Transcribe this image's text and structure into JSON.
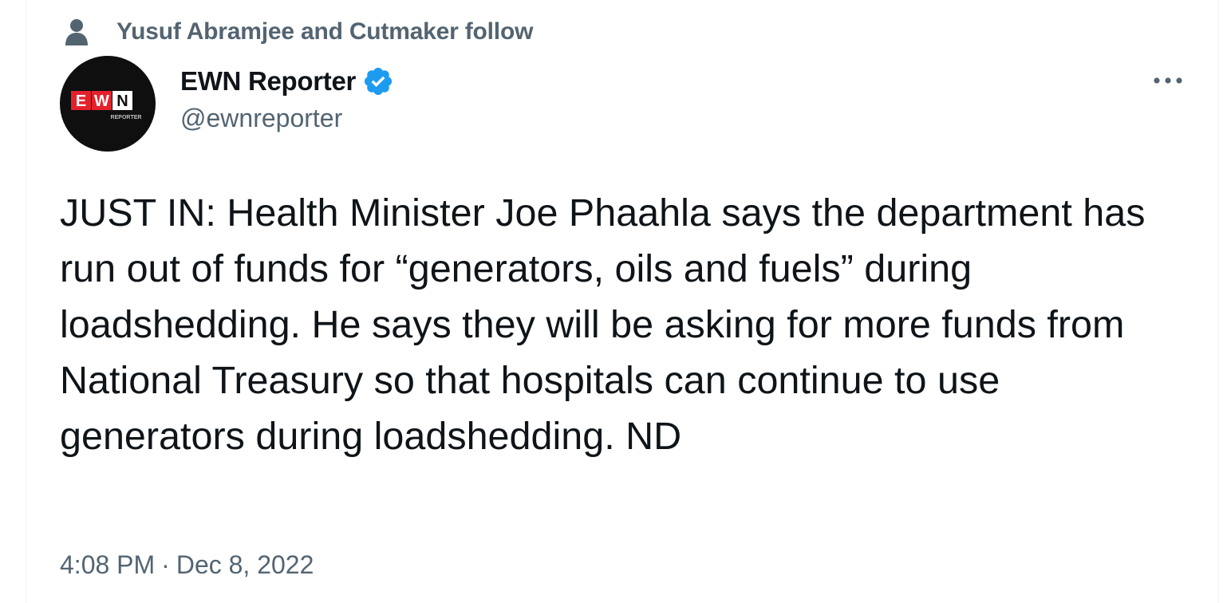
{
  "social_context": {
    "text": "Yusuf Abramjee and Cutmaker follow",
    "icon": "person-icon"
  },
  "author": {
    "display_name": "EWN Reporter",
    "handle": "@ewnreporter",
    "verified": true,
    "verified_color": "#1d9bf0",
    "avatar": {
      "logo_letters": [
        "E",
        "W",
        "N"
      ],
      "logo_subtext": "REPORTER",
      "logo_red": "#e4212b",
      "logo_bg": "#0f0f0f"
    }
  },
  "tweet": {
    "text": "JUST IN: Health Minister Joe Phaahla says the department has run out of funds for “generators, oils and fuels” during loadshedding. He says they will be asking for more funds from National Treasury so that hospitals can continue to use generators during loadshedding. ND"
  },
  "meta": {
    "time": "4:08 PM",
    "separator": "·",
    "date": "Dec 8, 2022"
  },
  "icons": {
    "more": "more-horizontal-icon"
  },
  "colors": {
    "text_primary": "#0f1419",
    "text_secondary": "#536471"
  }
}
